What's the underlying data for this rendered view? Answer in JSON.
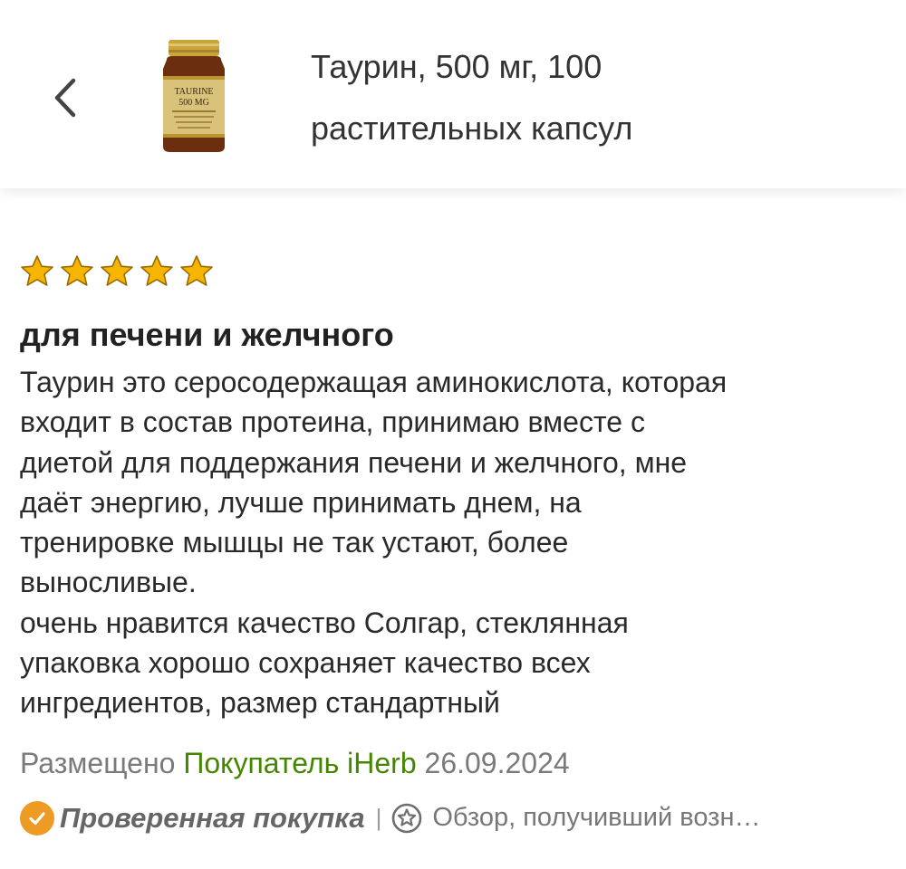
{
  "header": {
    "back_icon": "chevron-left-icon",
    "product_image": "supplement-bottle-icon",
    "product_label_line1": "TAURINE",
    "product_label_line2": "500 MG",
    "product_title": "Таурин, 500 мг, 100 растительных капсул"
  },
  "review": {
    "rating": 5,
    "rating_max": 5,
    "star_color": "#f6b500",
    "title": "для печени и желчного",
    "body": "Таурин это серосодержащая аминокислота, которая\nвходит в состав протеина, принимаю вместе с\nдиетой для поддержания печени и желчного, мне\nдаёт энергию, лучше принимать днем, на\nтренировке мышцы не так устают, более\nвыносливые.\nочень нравится качество Солгар,   стеклянная\nупаковка хорошо сохраняет качество всех\nингредиентов, размер стандартный",
    "posted_label": "Размещено",
    "author": "Покупатель iHerb",
    "date": "26.09.2024",
    "verified_label": "Проверенная покупка",
    "separator": "|",
    "reward_text": "Обзор, получивший возн…",
    "colors": {
      "author": "#458500",
      "verified_badge": "#ee9b26"
    }
  }
}
